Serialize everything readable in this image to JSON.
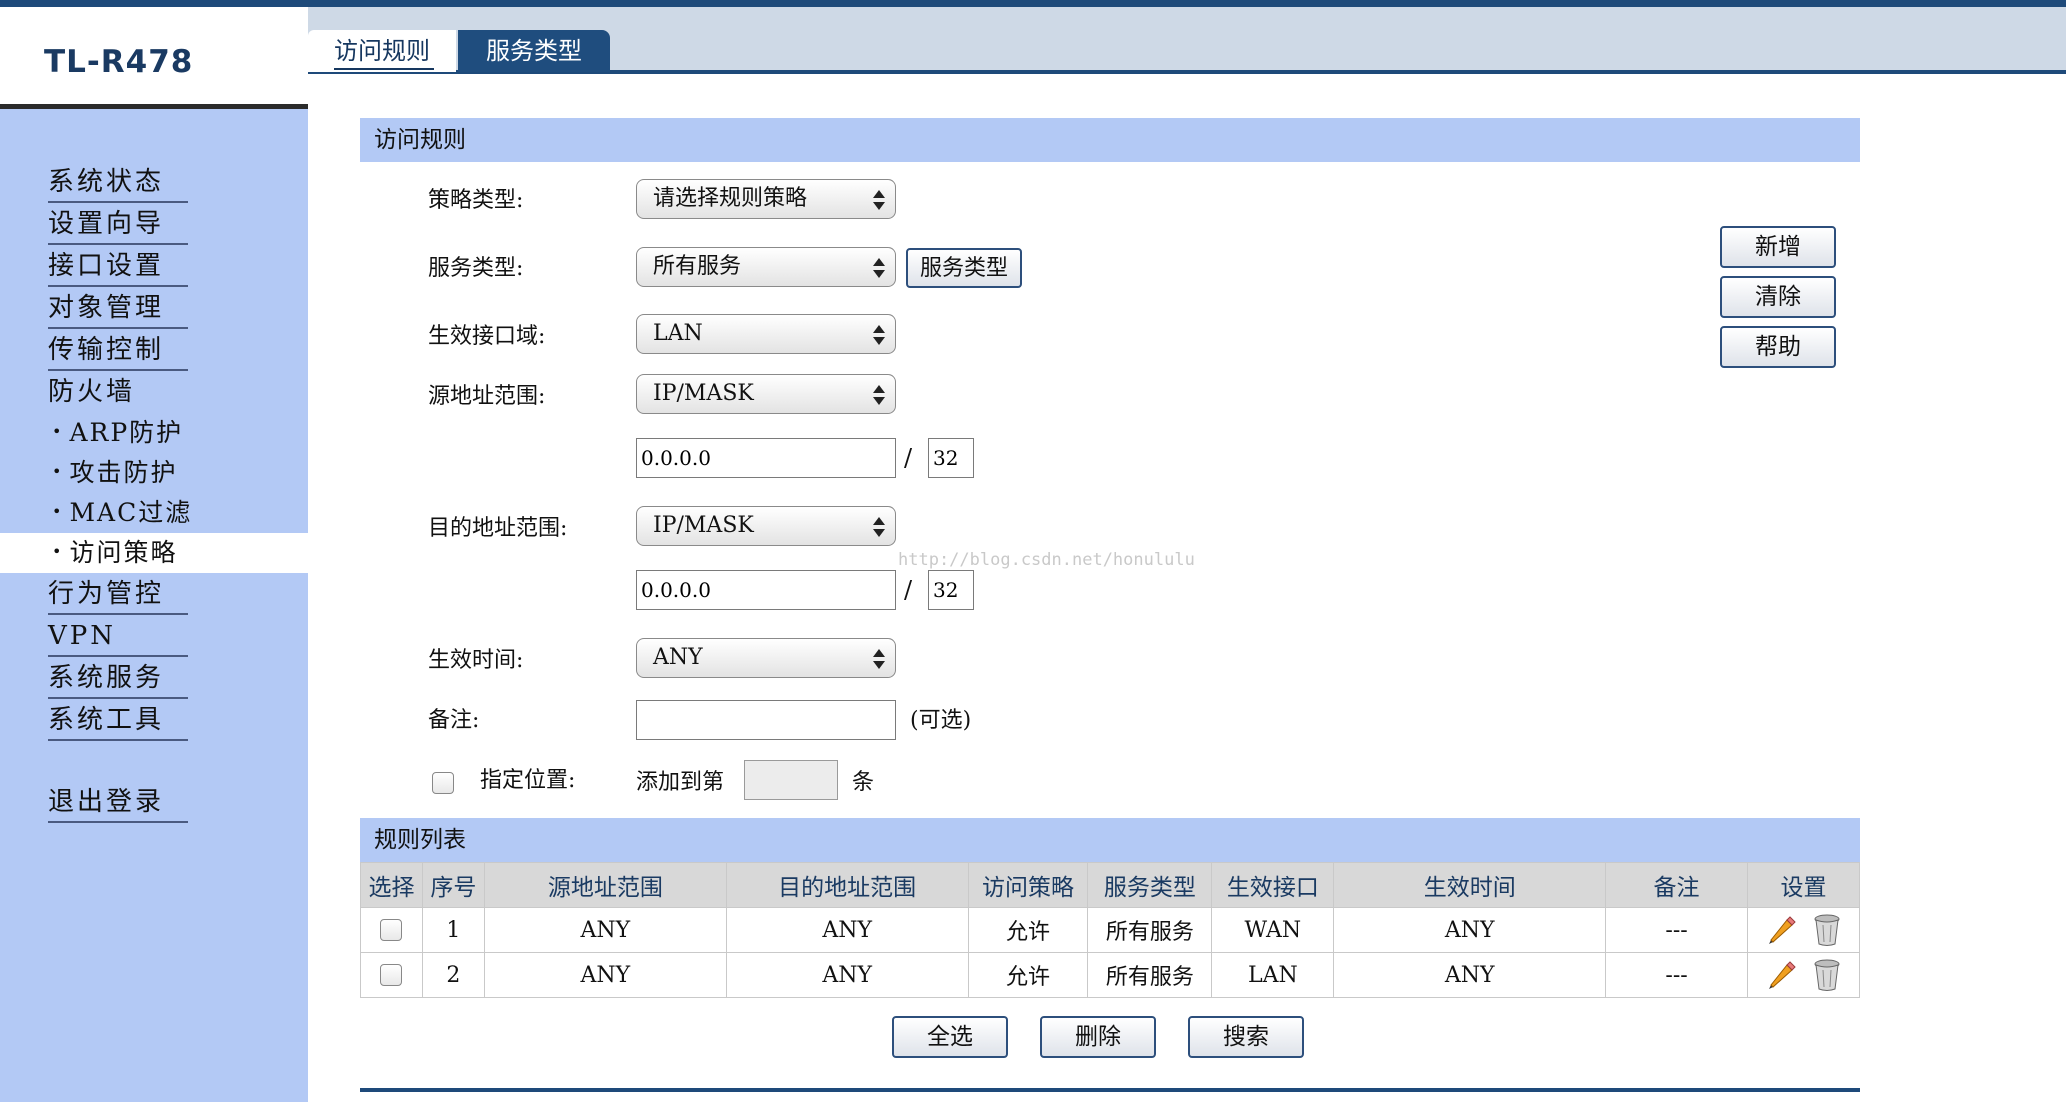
{
  "app": {
    "logo": "TL-R478"
  },
  "tabs": [
    {
      "label": "访问规则",
      "active": true
    },
    {
      "label": "服务类型",
      "active": false
    }
  ],
  "sidebar": {
    "items": [
      {
        "label": "系统状态"
      },
      {
        "label": "设置向导"
      },
      {
        "label": "接口设置"
      },
      {
        "label": "对象管理"
      },
      {
        "label": "传输控制"
      },
      {
        "label": "防火墙"
      }
    ],
    "subitems": [
      {
        "label": "ARP防护"
      },
      {
        "label": "攻击防护"
      },
      {
        "label": "MAC过滤"
      },
      {
        "label": "访问策略",
        "active": true
      }
    ],
    "items2": [
      {
        "label": "行为管控"
      },
      {
        "label": "VPN"
      },
      {
        "label": "系统服务"
      },
      {
        "label": "系统工具"
      }
    ],
    "logout": "退出登录"
  },
  "form": {
    "section_title": "访问规则",
    "policy_type_label": "策略类型:",
    "policy_type_value": "请选择规则策略",
    "service_type_label": "服务类型:",
    "service_type_value": "所有服务",
    "service_type_button": "服务类型",
    "zone_label": "生效接口域:",
    "zone_value": "LAN",
    "src_label": "源地址范围:",
    "src_mode": "IP/MASK",
    "src_ip": "0.0.0.0",
    "src_mask": "32",
    "dst_label": "目的地址范围:",
    "dst_mode": "IP/MASK",
    "dst_ip": "0.0.0.0",
    "dst_mask": "32",
    "mask_sep": "/",
    "time_label": "生效时间:",
    "time_value": "ANY",
    "note_label": "备注:",
    "note_value": "",
    "note_hint": "(可选)",
    "position_label": "指定位置:",
    "position_prefix": "添加到第",
    "position_value": "",
    "position_suffix": "条",
    "add_button": "新增",
    "clear_button": "清除",
    "help_button": "帮助"
  },
  "watermark": "http://blog.csdn.net/honululu",
  "table": {
    "section_title": "规则列表",
    "columns": [
      "选择",
      "序号",
      "源地址范围",
      "目的地址范围",
      "访问策略",
      "服务类型",
      "生效接口",
      "生效时间",
      "备注",
      "设置"
    ],
    "rows": [
      {
        "index": "1",
        "src": "ANY",
        "dst": "ANY",
        "policy": "允许",
        "service": "所有服务",
        "iface": "WAN",
        "time": "ANY",
        "note": "---"
      },
      {
        "index": "2",
        "src": "ANY",
        "dst": "ANY",
        "policy": "允许",
        "service": "所有服务",
        "iface": "LAN",
        "time": "ANY",
        "note": "---"
      }
    ],
    "select_all_button": "全选",
    "delete_button": "删除",
    "search_button": "搜索"
  }
}
